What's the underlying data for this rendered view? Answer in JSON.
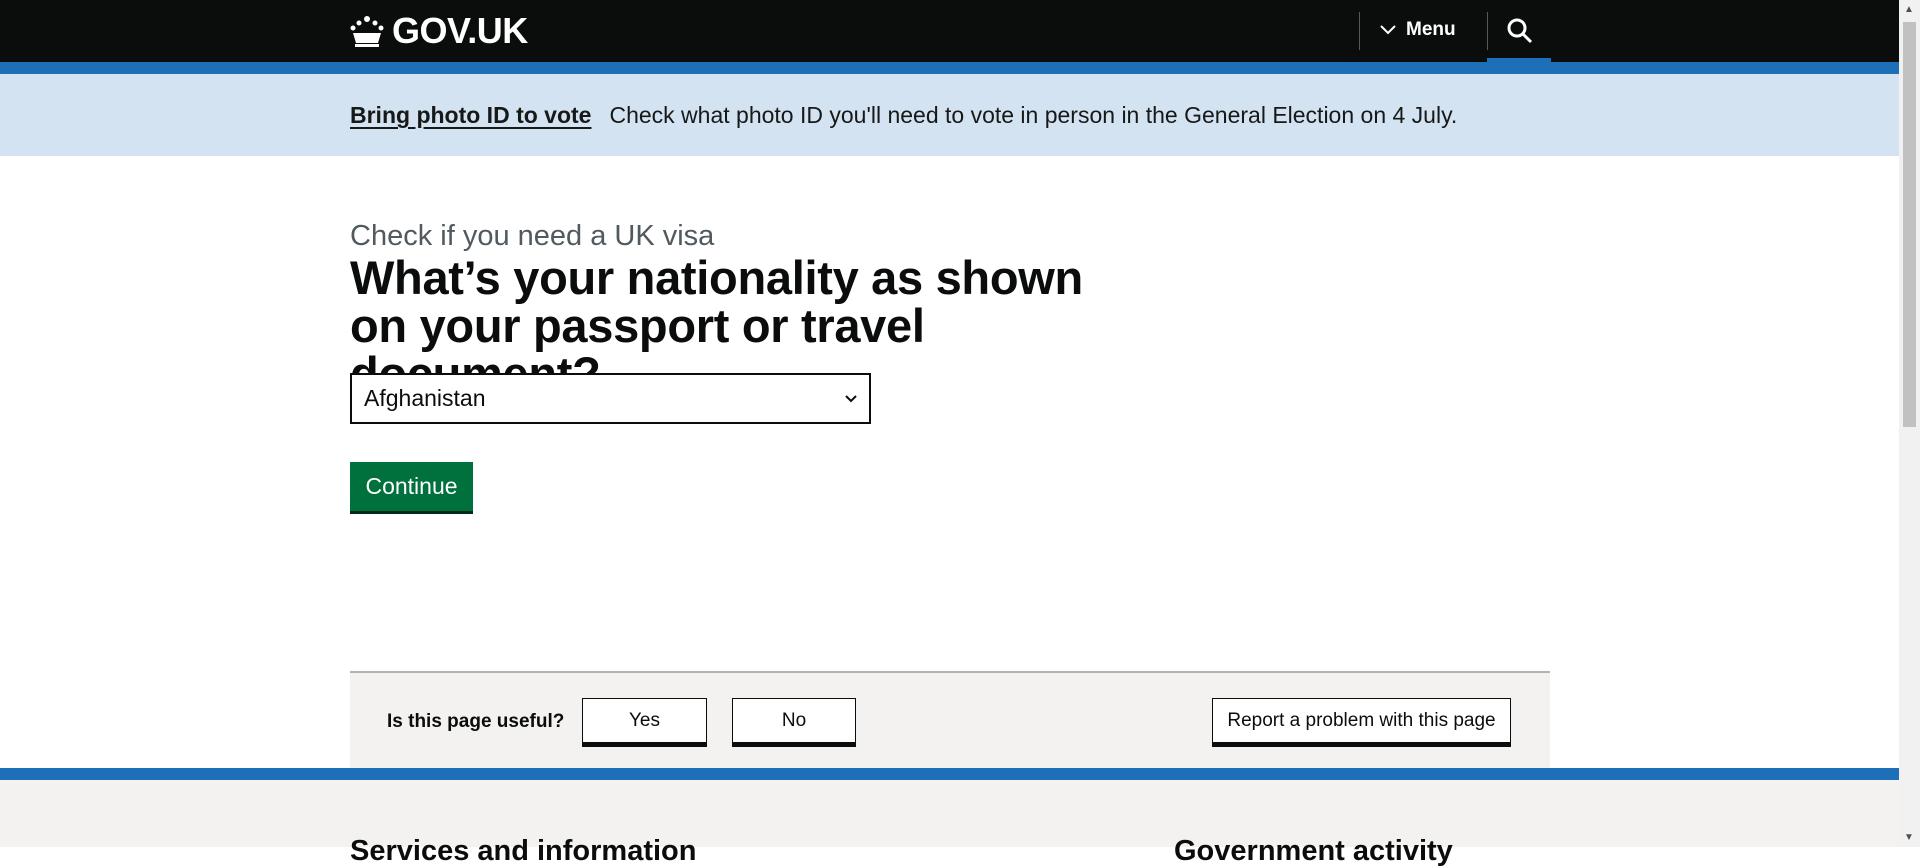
{
  "header": {
    "logo": "GOV.UK",
    "menu_label": "Menu"
  },
  "banner": {
    "link": "Bring photo ID to vote",
    "text": "Check what photo ID you'll need to vote in person in the General Election on 4 July."
  },
  "main": {
    "caption": "Check if you need a UK visa",
    "heading": "What’s your nationality as shown on your passport or travel document?",
    "select_value": "Afghanistan",
    "continue_label": "Continue"
  },
  "feedback": {
    "question": "Is this page useful?",
    "yes": "Yes",
    "no": "No",
    "report": "Report a problem with this page"
  },
  "footer": {
    "col1": "Services and information",
    "col2": "Government activity"
  },
  "colors": {
    "header": "#0b0c0c",
    "brand_blue": "#1d70b8",
    "banner": "#d2e2f1",
    "button_green": "#00703c"
  }
}
